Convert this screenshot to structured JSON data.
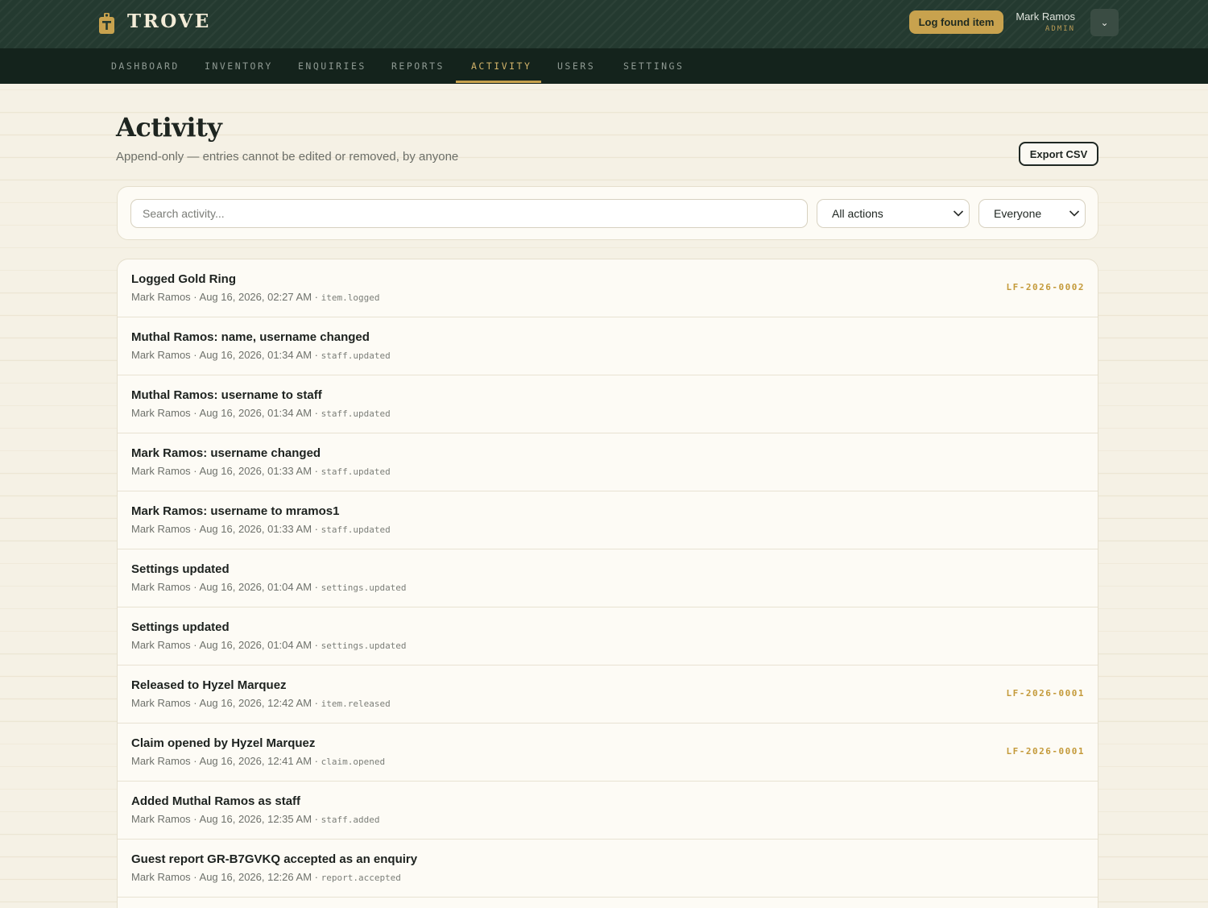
{
  "app": {
    "name": "TROVE",
    "log_button": "Log found item",
    "user_name": "Mark Ramos",
    "user_role": "ADMIN",
    "menu_glyph": "⌄"
  },
  "nav": {
    "items": [
      {
        "label": "DASHBOARD"
      },
      {
        "label": "INVENTORY"
      },
      {
        "label": "ENQUIRIES"
      },
      {
        "label": "REPORTS"
      },
      {
        "label": "ACTIVITY",
        "active": true
      },
      {
        "label": "USERS"
      },
      {
        "label": "SETTINGS"
      }
    ]
  },
  "page": {
    "title": "Activity",
    "subtitle": "Append-only — entries cannot be edited or removed, by anyone",
    "export_label": "Export CSV"
  },
  "filters": {
    "search_placeholder": "Search activity...",
    "action_select": "All actions",
    "actor_select": "Everyone"
  },
  "entries": [
    {
      "title": "Logged Gold Ring",
      "actor": "Mark Ramos",
      "time": "Aug 16, 2026, 02:27 AM",
      "code": "item.logged",
      "ref": "LF-2026-0002"
    },
    {
      "title": "Muthal Ramos: name, username changed",
      "actor": "Mark Ramos",
      "time": "Aug 16, 2026, 01:34 AM",
      "code": "staff.updated",
      "ref": ""
    },
    {
      "title": "Muthal Ramos: username to staff",
      "actor": "Mark Ramos",
      "time": "Aug 16, 2026, 01:34 AM",
      "code": "staff.updated",
      "ref": ""
    },
    {
      "title": "Mark Ramos: username changed",
      "actor": "Mark Ramos",
      "time": "Aug 16, 2026, 01:33 AM",
      "code": "staff.updated",
      "ref": ""
    },
    {
      "title": "Mark Ramos: username to mramos1",
      "actor": "Mark Ramos",
      "time": "Aug 16, 2026, 01:33 AM",
      "code": "staff.updated",
      "ref": ""
    },
    {
      "title": "Settings updated",
      "actor": "Mark Ramos",
      "time": "Aug 16, 2026, 01:04 AM",
      "code": "settings.updated",
      "ref": ""
    },
    {
      "title": "Settings updated",
      "actor": "Mark Ramos",
      "time": "Aug 16, 2026, 01:04 AM",
      "code": "settings.updated",
      "ref": ""
    },
    {
      "title": "Released to Hyzel Marquez",
      "actor": "Mark Ramos",
      "time": "Aug 16, 2026, 12:42 AM",
      "code": "item.released",
      "ref": "LF-2026-0001"
    },
    {
      "title": "Claim opened by Hyzel Marquez",
      "actor": "Mark Ramos",
      "time": "Aug 16, 2026, 12:41 AM",
      "code": "claim.opened",
      "ref": "LF-2026-0001"
    },
    {
      "title": "Added Muthal Ramos as staff",
      "actor": "Mark Ramos",
      "time": "Aug 16, 2026, 12:35 AM",
      "code": "staff.added",
      "ref": ""
    },
    {
      "title": "Guest report GR-B7GVKQ accepted as an enquiry",
      "actor": "Mark Ramos",
      "time": "Aug 16, 2026, 12:26 AM",
      "code": "report.accepted",
      "ref": ""
    }
  ],
  "colors": {
    "topbar": "#243a30",
    "nav": "#14231c",
    "accent": "#c8a24e",
    "background": "#f5f1e5"
  }
}
